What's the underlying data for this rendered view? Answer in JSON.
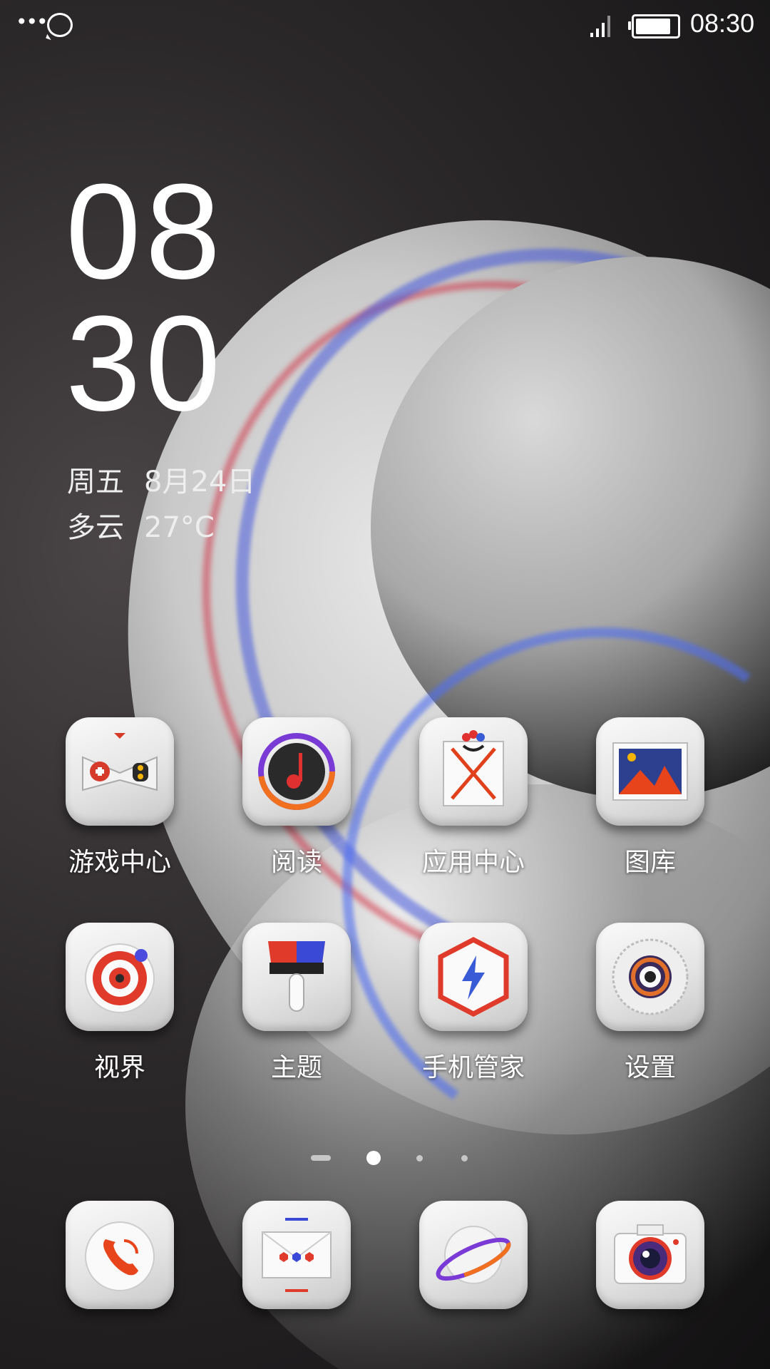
{
  "status_bar": {
    "more_icon": "more-dots-icon",
    "message_icon": "chat-bubble-icon",
    "signal_icon": "cellular-signal-icon",
    "battery_icon": "battery-icon",
    "battery_level": 0.85,
    "time": "08:30"
  },
  "clock": {
    "hour": "08",
    "minute": "30",
    "weekday": "周五",
    "date": "8月24日",
    "weather": "多云",
    "temperature": "27°C"
  },
  "apps": [
    {
      "label": "游戏中心",
      "icon": "gamepad-icon"
    },
    {
      "label": "阅读",
      "icon": "reading-icon"
    },
    {
      "label": "应用中心",
      "icon": "app-center-icon"
    },
    {
      "label": "图库",
      "icon": "gallery-icon"
    },
    {
      "label": "视界",
      "icon": "video-icon"
    },
    {
      "label": "主题",
      "icon": "paintbrush-icon"
    },
    {
      "label": "手机管家",
      "icon": "shield-icon"
    },
    {
      "label": "设置",
      "icon": "settings-gear-icon"
    }
  ],
  "pager": {
    "pages": 4,
    "current": 2
  },
  "dock": [
    {
      "icon": "phone-icon"
    },
    {
      "icon": "messages-icon"
    },
    {
      "icon": "browser-icon"
    },
    {
      "icon": "camera-icon"
    }
  ]
}
